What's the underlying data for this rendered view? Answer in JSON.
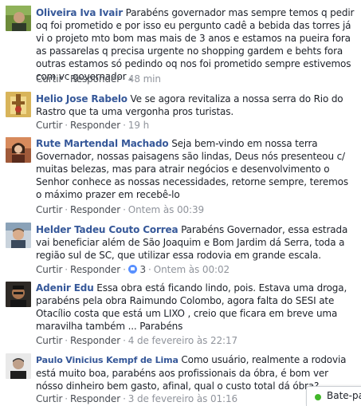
{
  "comments": [
    {
      "author": "Oliveira Iva Ivair",
      "text": "Parabéns governador mas sempre temos q pedir oq foi prometido e por isso eu pergunto cadê a bebida das torres já vi o projeto mto bom mas mais de 3 anos e estamos na pueira fora as passarelas q precisa urgente no shopping gardem e behts fora outras estamos só pedindo oq nos foi prometido sempre estivemos com vc governador .",
      "like": "Curtir",
      "reply": "Responder",
      "time": "48 min",
      "avatar": "avatar-green"
    },
    {
      "author": "Helio Jose Rabelo",
      "text": "Ve se agora revitaliza a nossa serra do Rio do Rastro que ta uma vergonha pros turistas.",
      "like": "Curtir",
      "reply": "Responder",
      "time": "19 h",
      "avatar": "avatar-church"
    },
    {
      "author": "Rute Martendal Machado",
      "text": "Seja bem-vindo em nossa terra Governador, nossas paisagens são lindas, Deus nós presenteou c/ muitas belezas, mas para atrair negócios e desenvolvimento o Senhor conhece as nossas necessidades, retorne sempre, teremos o máximo prazer em recebê-lo",
      "like": "Curtir",
      "reply": "Responder",
      "time": "Ontem às 00:39",
      "avatar": "avatar-woman"
    },
    {
      "author": "Helder Tadeu Couto Correa",
      "text": "Parabéns Governador, essa estrada vai beneficiar além de São Joaquim e Bom Jardim dá Serra, toda a região sul de SC, que utilizar essa rodovia em grande escala.",
      "like": "Curtir",
      "reply": "Responder",
      "reactions": "3",
      "time": "Ontem às 00:02",
      "avatar": "avatar-man"
    },
    {
      "author": "Adenir Edu",
      "text": "Essa obra está ficando lindo, pois. Estava uma droga, parabéns pela obra Raimundo Colombo, agora falta do SESI ate Otacílio costa que está um LIXO , creio que ficara em breve uma maravilha também ... Parabéns",
      "like": "Curtir",
      "reply": "Responder",
      "time": "4 de fevereiro às 22:17",
      "avatar": "avatar-man-dark"
    },
    {
      "author": "Paulo Vinicius Kempf de Lima",
      "text": "Como usuário, realmente a rodovia está muito boa, parabéns aos profissionais da óbra, é bom ver nósso dinheiro bem gasto, afinal, qual o custo total dá óbra?",
      "like": "Curtir",
      "reply": "Responder",
      "time": "3 de fevereiro às 01:16",
      "avatar": "avatar-man-gray"
    }
  ],
  "chat": {
    "label": "Bate-pa",
    "status_color": "#42b72a"
  }
}
